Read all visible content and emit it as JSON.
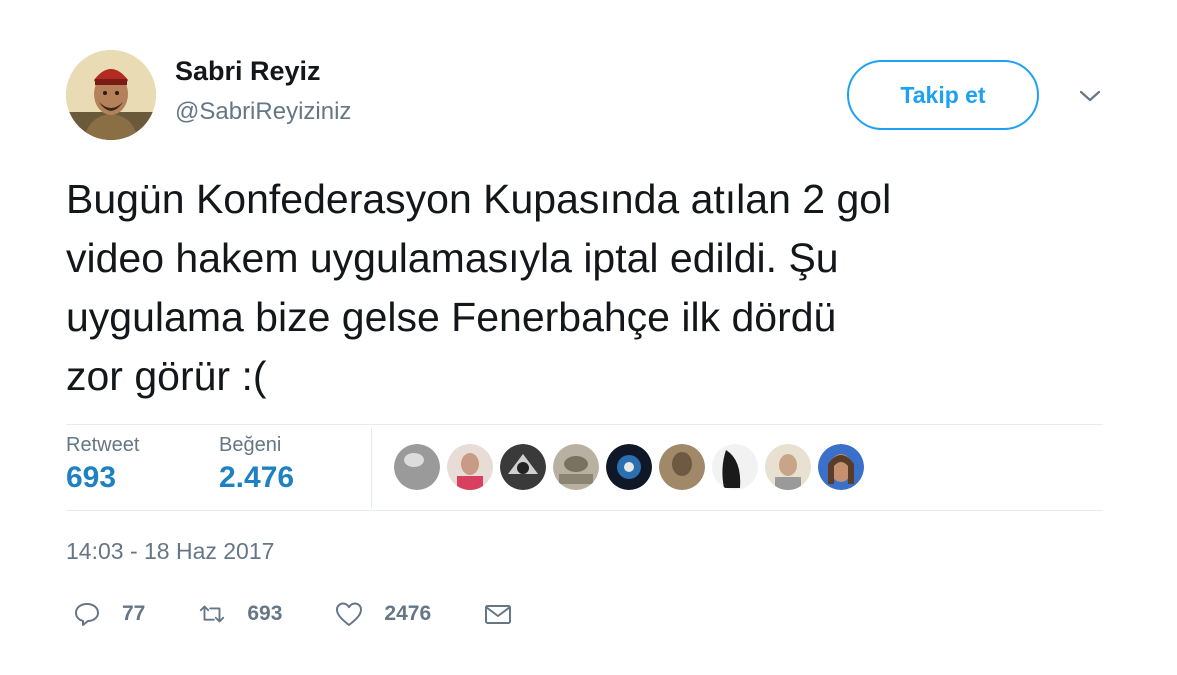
{
  "user": {
    "display_name": "Sabri Reyiz",
    "handle": "@SabriReyiziniz"
  },
  "follow_button": {
    "label": "Takip et"
  },
  "tweet": {
    "text": "Bugün Konfederasyon Kupasında atılan 2 gol\nvideo hakem uygulamasıyla iptal edildi. Şu\nuygulama bize gelse Fenerbahçe ilk dördü\nzor görür :("
  },
  "stats": {
    "retweets_label": "Retweet",
    "retweets_value": "693",
    "likes_label": "Beğeni",
    "likes_value": "2.476"
  },
  "timestamp": "14:03 - 18 Haz 2017",
  "actions": {
    "reply_count": "77",
    "retweet_count": "693",
    "like_count": "2476"
  },
  "colors": {
    "accent": "#1da1f2",
    "stat_value": "#1d81c2",
    "muted": "#657786",
    "text": "#14171a",
    "divider": "#e6ecf0"
  },
  "icons": {
    "more": "chevron-down-icon",
    "reply": "reply-icon",
    "retweet": "retweet-icon",
    "like": "heart-icon",
    "message": "envelope-icon"
  }
}
